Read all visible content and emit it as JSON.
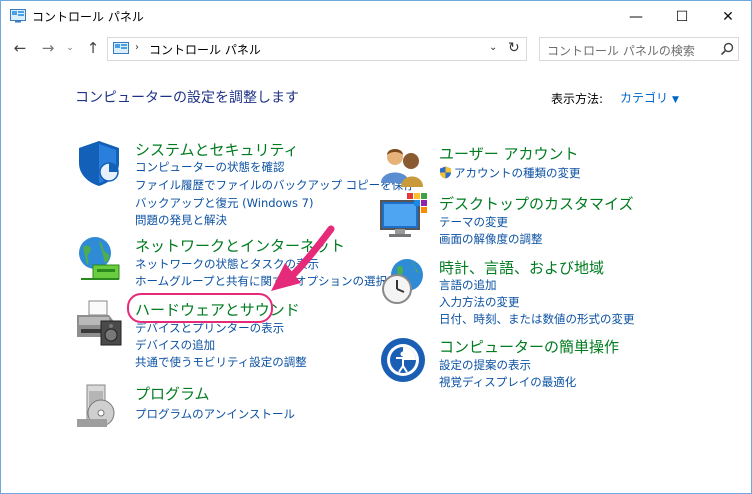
{
  "window": {
    "title": "コントロール パネル",
    "controls": {
      "minimize": "—",
      "maximize": "☐",
      "close": "✕"
    }
  },
  "nav": {
    "back": "←",
    "forward": "→",
    "history": "⌄",
    "up": "↑",
    "address": "コントロール パネル",
    "separator": "›",
    "dropdown": "⌄",
    "refresh": "↻"
  },
  "search": {
    "placeholder": "コントロール パネルの検索"
  },
  "header": {
    "title": "コンピューターの設定を調整します",
    "view_label": "表示方法:",
    "view_value": "カテゴリ"
  },
  "categories_left": [
    {
      "icon": "security-shield-icon",
      "title": "システムとセキュリティ",
      "links": [
        "コンピューターの状態を確認",
        "ファイル履歴でファイルのバックアップ コピーを保存",
        "バックアップと復元 (Windows 7)",
        "問題の発見と解決"
      ]
    },
    {
      "icon": "network-globe-icon",
      "title": "ネットワークとインターネット",
      "links": [
        "ネットワークの状態とタスクの表示",
        "ホームグループと共有に関するオプションの選択"
      ]
    },
    {
      "icon": "printer-icon",
      "title": "ハードウェアとサウンド",
      "links": [
        "デバイスとプリンターの表示",
        "デバイスの追加",
        "共通で使うモビリティ設定の調整"
      ]
    },
    {
      "icon": "programs-icon",
      "title": "プログラム",
      "links": [
        "プログラムのアンインストール"
      ]
    }
  ],
  "categories_right": [
    {
      "icon": "user-accounts-icon",
      "title": "ユーザー アカウント",
      "links": [
        "アカウントの種類の変更"
      ]
    },
    {
      "icon": "desktop-monitor-icon",
      "title": "デスクトップのカスタマイズ",
      "links": [
        "テーマの変更",
        "画面の解像度の調整"
      ]
    },
    {
      "icon": "clock-globe-icon",
      "title": "時計、言語、および地域",
      "links": [
        "言語の追加",
        "入力方法の変更",
        "日付、時刻、または数値の形式の変更"
      ]
    },
    {
      "icon": "ease-of-access-icon",
      "title": "コンピューターの簡単操作",
      "links": [
        "設定の提案の表示",
        "視覚ディスプレイの最適化"
      ]
    }
  ],
  "colors": {
    "category_title": "#007b1f",
    "link": "#0b51a3",
    "page_title": "#1e3287",
    "annotation": "#e62a7a"
  }
}
